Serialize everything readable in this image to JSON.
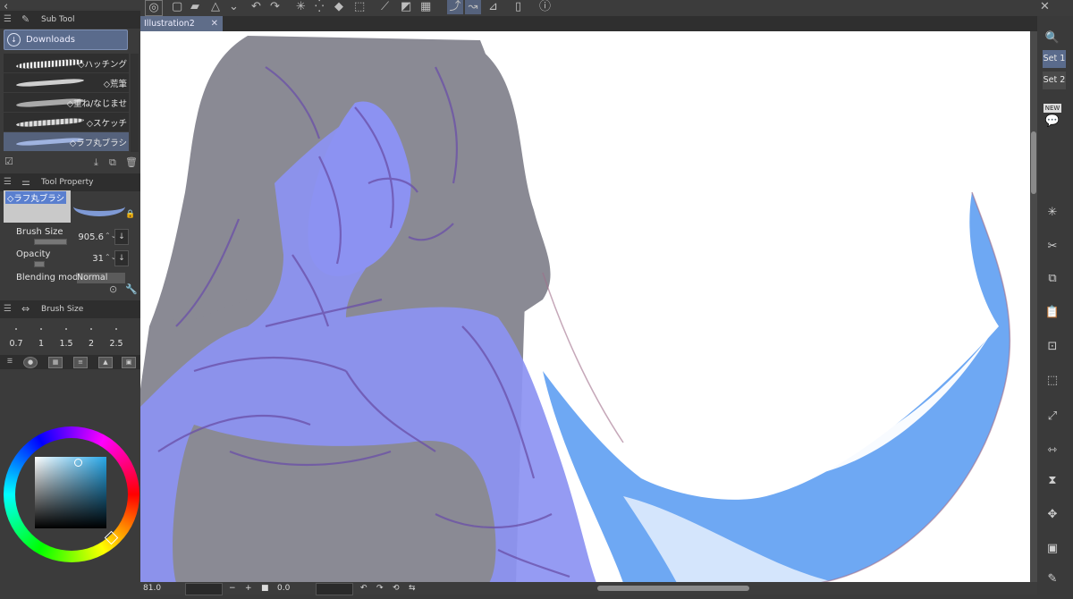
{
  "app": {
    "document_tab": "Illustration2",
    "close_glyph": "✕"
  },
  "subtool_panel": {
    "title": "Sub Tool",
    "group": "Downloads",
    "brushes": [
      {
        "label": "◇ハッチング"
      },
      {
        "label": "◇荒筆"
      },
      {
        "label": "◇重ね/なじませ"
      },
      {
        "label": "◇スケッチ"
      },
      {
        "label": "◇ラフ丸ブラシ"
      }
    ]
  },
  "tool_property": {
    "title": "Tool Property",
    "brush_name": "◇ラフ丸ブラシ",
    "brush_size_label": "Brush Size",
    "brush_size_value": "905.6",
    "opacity_label": "Opacity",
    "opacity_value": "31",
    "blending_label": "Blending mode",
    "blending_value": "Normal"
  },
  "brush_size_panel": {
    "title": "Brush Size",
    "sizes": [
      "0.7",
      "1",
      "1.5",
      "2",
      "2.5"
    ]
  },
  "color": {
    "current": "#2aa6e6"
  },
  "status_bar": {
    "zoom": "81.0",
    "rotation": "0.0",
    "minus": "−",
    "plus": "+"
  },
  "right_panel": {
    "set1": "Set 1",
    "set2": "Set 2",
    "new_badge": "NEW"
  }
}
